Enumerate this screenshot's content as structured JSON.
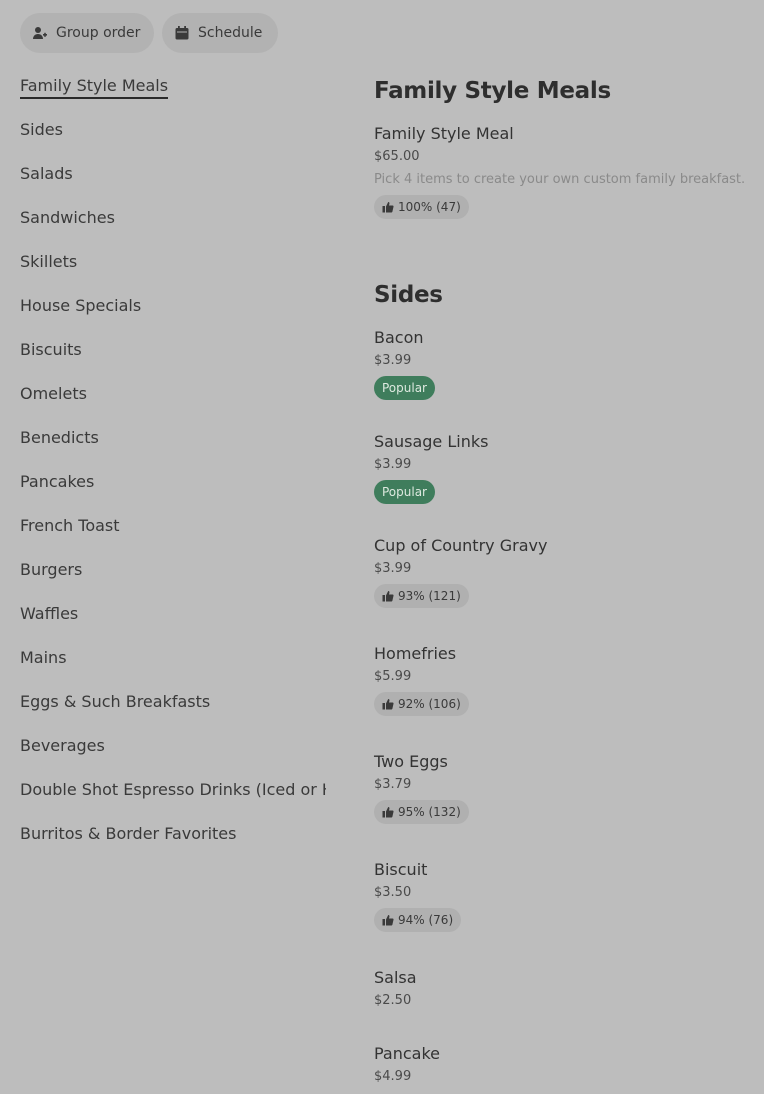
{
  "toolbar": {
    "group_order_label": "Group order",
    "schedule_label": "Schedule",
    "group_icon": "add-person-icon",
    "schedule_icon": "calendar-icon"
  },
  "sidebar": {
    "items": [
      {
        "label": "Family Style Meals",
        "active": true
      },
      {
        "label": "Sides"
      },
      {
        "label": "Salads"
      },
      {
        "label": "Sandwiches"
      },
      {
        "label": "Skillets"
      },
      {
        "label": "House Specials"
      },
      {
        "label": "Biscuits"
      },
      {
        "label": "Omelets"
      },
      {
        "label": "Benedicts"
      },
      {
        "label": "Pancakes"
      },
      {
        "label": "French Toast"
      },
      {
        "label": "Burgers"
      },
      {
        "label": "Waffles"
      },
      {
        "label": "Mains"
      },
      {
        "label": "Eggs & Such Breakfasts"
      },
      {
        "label": "Beverages"
      },
      {
        "label": "Double Shot Espresso Drinks (Iced or Hot)"
      },
      {
        "label": "Burritos & Border Favorites"
      }
    ]
  },
  "sections": [
    {
      "title": "Family Style Meals",
      "items": [
        {
          "name": "Family Style Meal",
          "price": "$65.00",
          "description": "Pick 4 items to create your own custom family breakfast.",
          "rating": "100% (47)"
        }
      ]
    },
    {
      "title": "Sides",
      "items": [
        {
          "name": "Bacon",
          "price": "$3.99",
          "badge": "Popular"
        },
        {
          "name": "Sausage Links",
          "price": "$3.99",
          "badge": "Popular"
        },
        {
          "name": "Cup of Country Gravy",
          "price": "$3.99",
          "rating": "93% (121)"
        },
        {
          "name": "Homefries",
          "price": "$5.99",
          "rating": "92% (106)"
        },
        {
          "name": "Two Eggs",
          "price": "$3.79",
          "rating": "95% (132)"
        },
        {
          "name": "Biscuit",
          "price": "$3.50",
          "rating": "94% (76)"
        },
        {
          "name": "Salsa",
          "price": "$2.50"
        },
        {
          "name": "Pancake",
          "price": "$4.99"
        }
      ]
    }
  ],
  "colors": {
    "background": "#bdbdbd",
    "popular_badge": "#3f7d5c",
    "rating_badge": "#b0b0b0"
  }
}
